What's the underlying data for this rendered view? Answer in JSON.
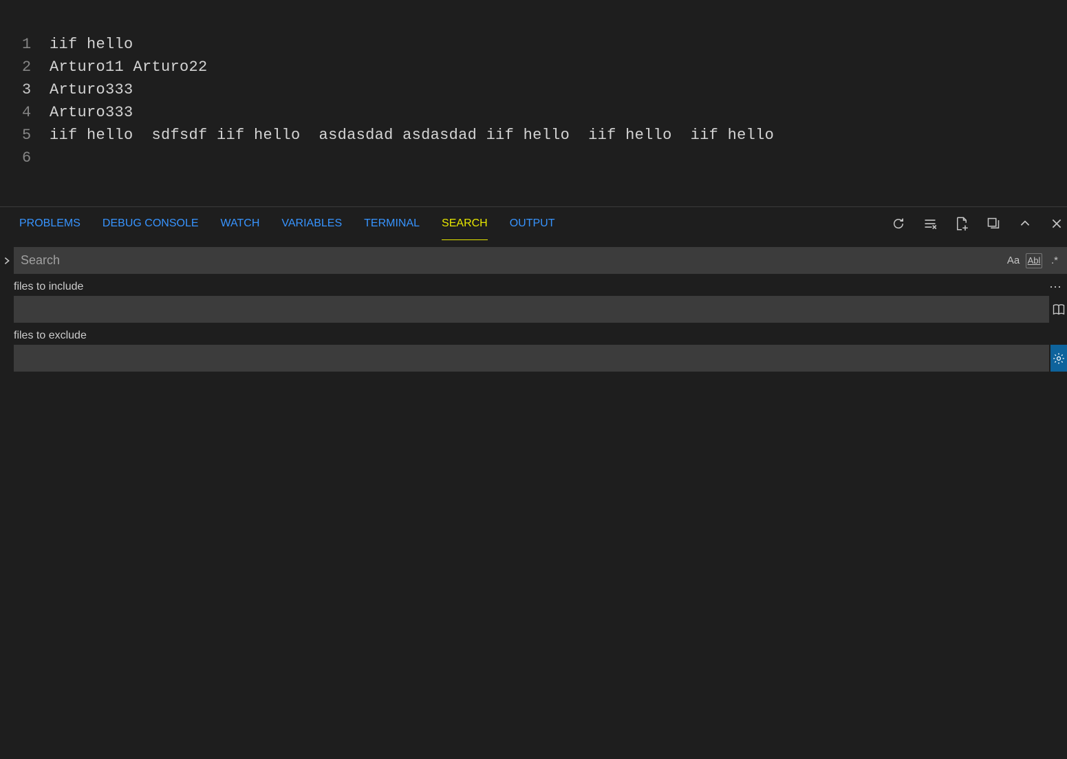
{
  "editor": {
    "lines": [
      {
        "num": "1",
        "text": "iif hello"
      },
      {
        "num": "2",
        "text": "Arturo11 Arturo22"
      },
      {
        "num": "3",
        "text": "Arturo333"
      },
      {
        "num": "4",
        "text": "Arturo333"
      },
      {
        "num": "5",
        "text": "iif hello  sdfsdf iif hello  asdasdad asdasdad iif hello  iif hello  iif hello"
      },
      {
        "num": "6",
        "text": ""
      }
    ],
    "active_line": 3
  },
  "panel": {
    "tabs": {
      "problems": "PROBLEMS",
      "debug_console": "DEBUG CONSOLE",
      "watch": "WATCH",
      "variables": "VARIABLES",
      "terminal": "TERMINAL",
      "search": "SEARCH",
      "output": "OUTPUT"
    },
    "active_tab": "search",
    "search": {
      "placeholder": "Search",
      "include_label": "files to include",
      "exclude_label": "files to exclude",
      "case_option": "Aa",
      "word_option": "Abl",
      "regex_option": ".*"
    }
  }
}
